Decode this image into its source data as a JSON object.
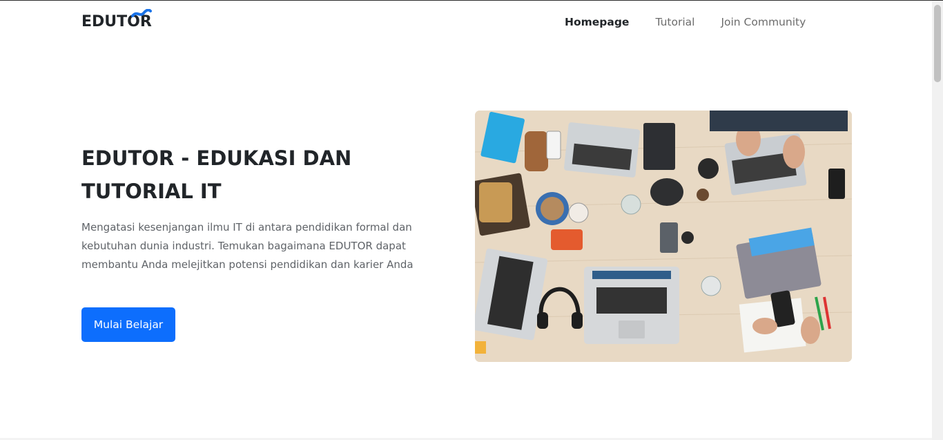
{
  "navbar": {
    "brand": "EDUTOR",
    "links": [
      {
        "label": "Homepage",
        "active": true
      },
      {
        "label": "Tutorial",
        "active": false
      },
      {
        "label": "Join Community",
        "active": false
      }
    ]
  },
  "hero": {
    "title": "EDUTOR - EDUKASI DAN TUTORIAL IT",
    "description": "Mengatasi kesenjangan ilmu IT di antara pendidikan formal dan kebutuhan dunia industri. Temukan bagaimana EDUTOR dapat membantu Anda melejitkan potensi pendidikan dan karier Anda",
    "cta_label": "Mulai Belajar"
  },
  "colors": {
    "accent": "#0d6efd",
    "brand_swoosh": "#1a73e8",
    "text_dark": "#212529",
    "text_muted": "#5f6368"
  },
  "icons": {
    "brand_mark": "swoosh-icon"
  }
}
